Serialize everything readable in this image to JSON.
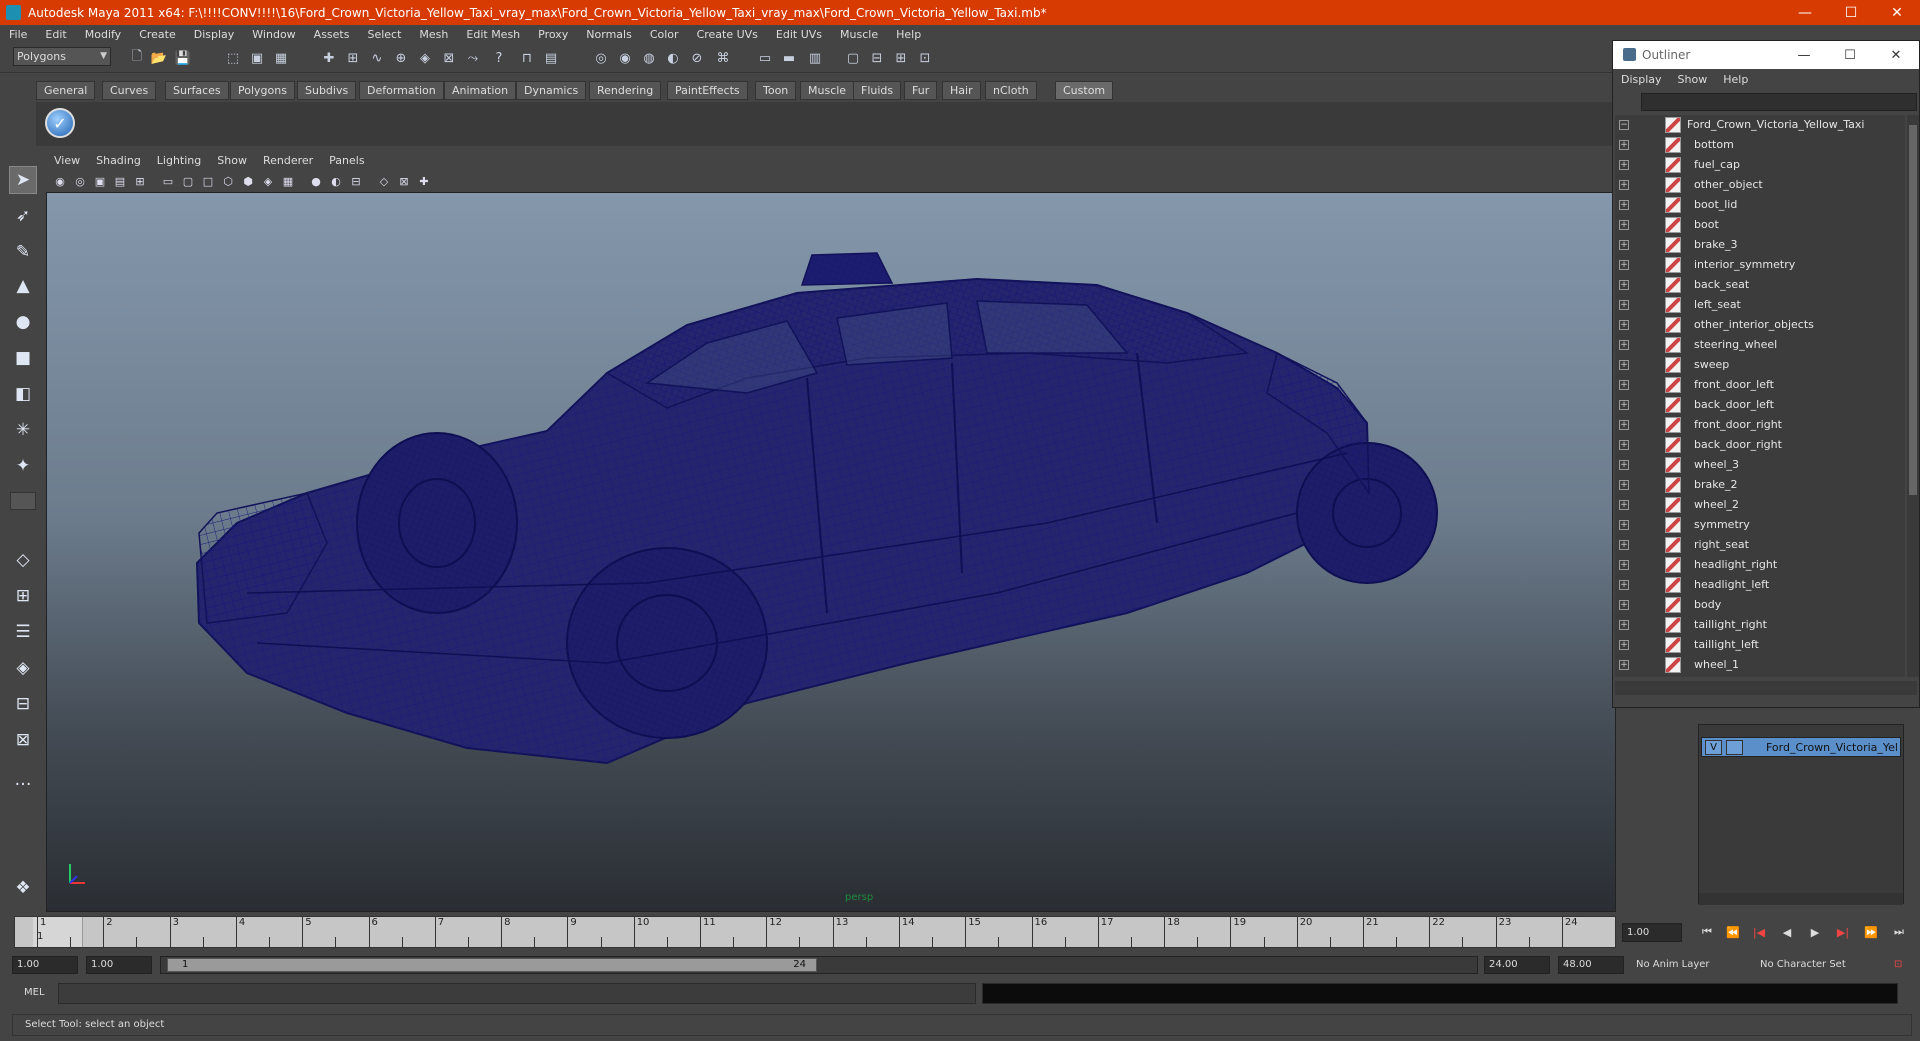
{
  "window": {
    "title": "Autodesk Maya 2011 x64: F:\\!!!!CONV!!!!\\16\\Ford_Crown_Victoria_Yellow_Taxi_vray_max\\Ford_Crown_Victoria_Yellow_Taxi_vray_max\\Ford_Crown_Victoria_Yellow_Taxi.mb*",
    "minimize": "—",
    "maximize": "☐",
    "close": "✕",
    "accent": "#d83b01"
  },
  "menubar": [
    "File",
    "Edit",
    "Modify",
    "Create",
    "Display",
    "Window",
    "Assets",
    "Select",
    "Mesh",
    "Edit Mesh",
    "Proxy",
    "Normals",
    "Color",
    "Create UVs",
    "Edit UVs",
    "Muscle",
    "Help"
  ],
  "statusline": {
    "mode": "Polygons"
  },
  "shelf": {
    "tabs": [
      "General",
      "Curves",
      "Surfaces",
      "Polygons",
      "Subdivs",
      "Deformation",
      "Animation",
      "Dynamics",
      "Rendering",
      "PaintEffects",
      "Toon",
      "Muscle",
      "Fluids",
      "Fur",
      "Hair",
      "nCloth",
      "Custom"
    ],
    "active_tab": "Custom"
  },
  "viewport": {
    "menu": [
      "View",
      "Shading",
      "Lighting",
      "Show",
      "Renderer",
      "Panels"
    ],
    "camera_label": "persp",
    "wire_color": "#1a1a7a"
  },
  "timeslider": {
    "ticks": [
      "1",
      "2",
      "3",
      "4",
      "5",
      "6",
      "7",
      "8",
      "9",
      "10",
      "11",
      "12",
      "13",
      "14",
      "15",
      "16",
      "17",
      "18",
      "19",
      "20",
      "21",
      "22",
      "23",
      "24"
    ],
    "current_frame": "1",
    "current_time_field": "1.00"
  },
  "range": {
    "start_time": "1.00",
    "playback_start": "1.00",
    "handle_start": "1",
    "handle_end": "24",
    "playback_end": "24.00",
    "end_time": "48.00",
    "anim_layer": "No Anim Layer",
    "character_set": "No Character Set"
  },
  "cmdline": {
    "label": "MEL"
  },
  "helpline": {
    "text": "Select Tool: select an object"
  },
  "outliner": {
    "title": "Outliner",
    "menu": [
      "Display",
      "Show",
      "Help"
    ],
    "root": "Ford_Crown_Victoria_Yellow_Taxi",
    "children": [
      "bottom",
      "fuel_cap",
      "other_object",
      "boot_lid",
      "boot",
      "brake_3",
      "interior_symmetry",
      "back_seat",
      "left_seat",
      "other_interior_objects",
      "steering_wheel",
      "sweep",
      "front_door_left",
      "back_door_left",
      "front_door_right",
      "back_door_right",
      "wheel_3",
      "brake_2",
      "wheel_2",
      "symmetry",
      "right_seat",
      "headlight_right",
      "headlight_left",
      "body",
      "taillight_right",
      "taillight_left",
      "wheel_1"
    ]
  },
  "layers": {
    "visible_flag": "V",
    "layer_name": "Ford_Crown_Victoria_Yell"
  }
}
